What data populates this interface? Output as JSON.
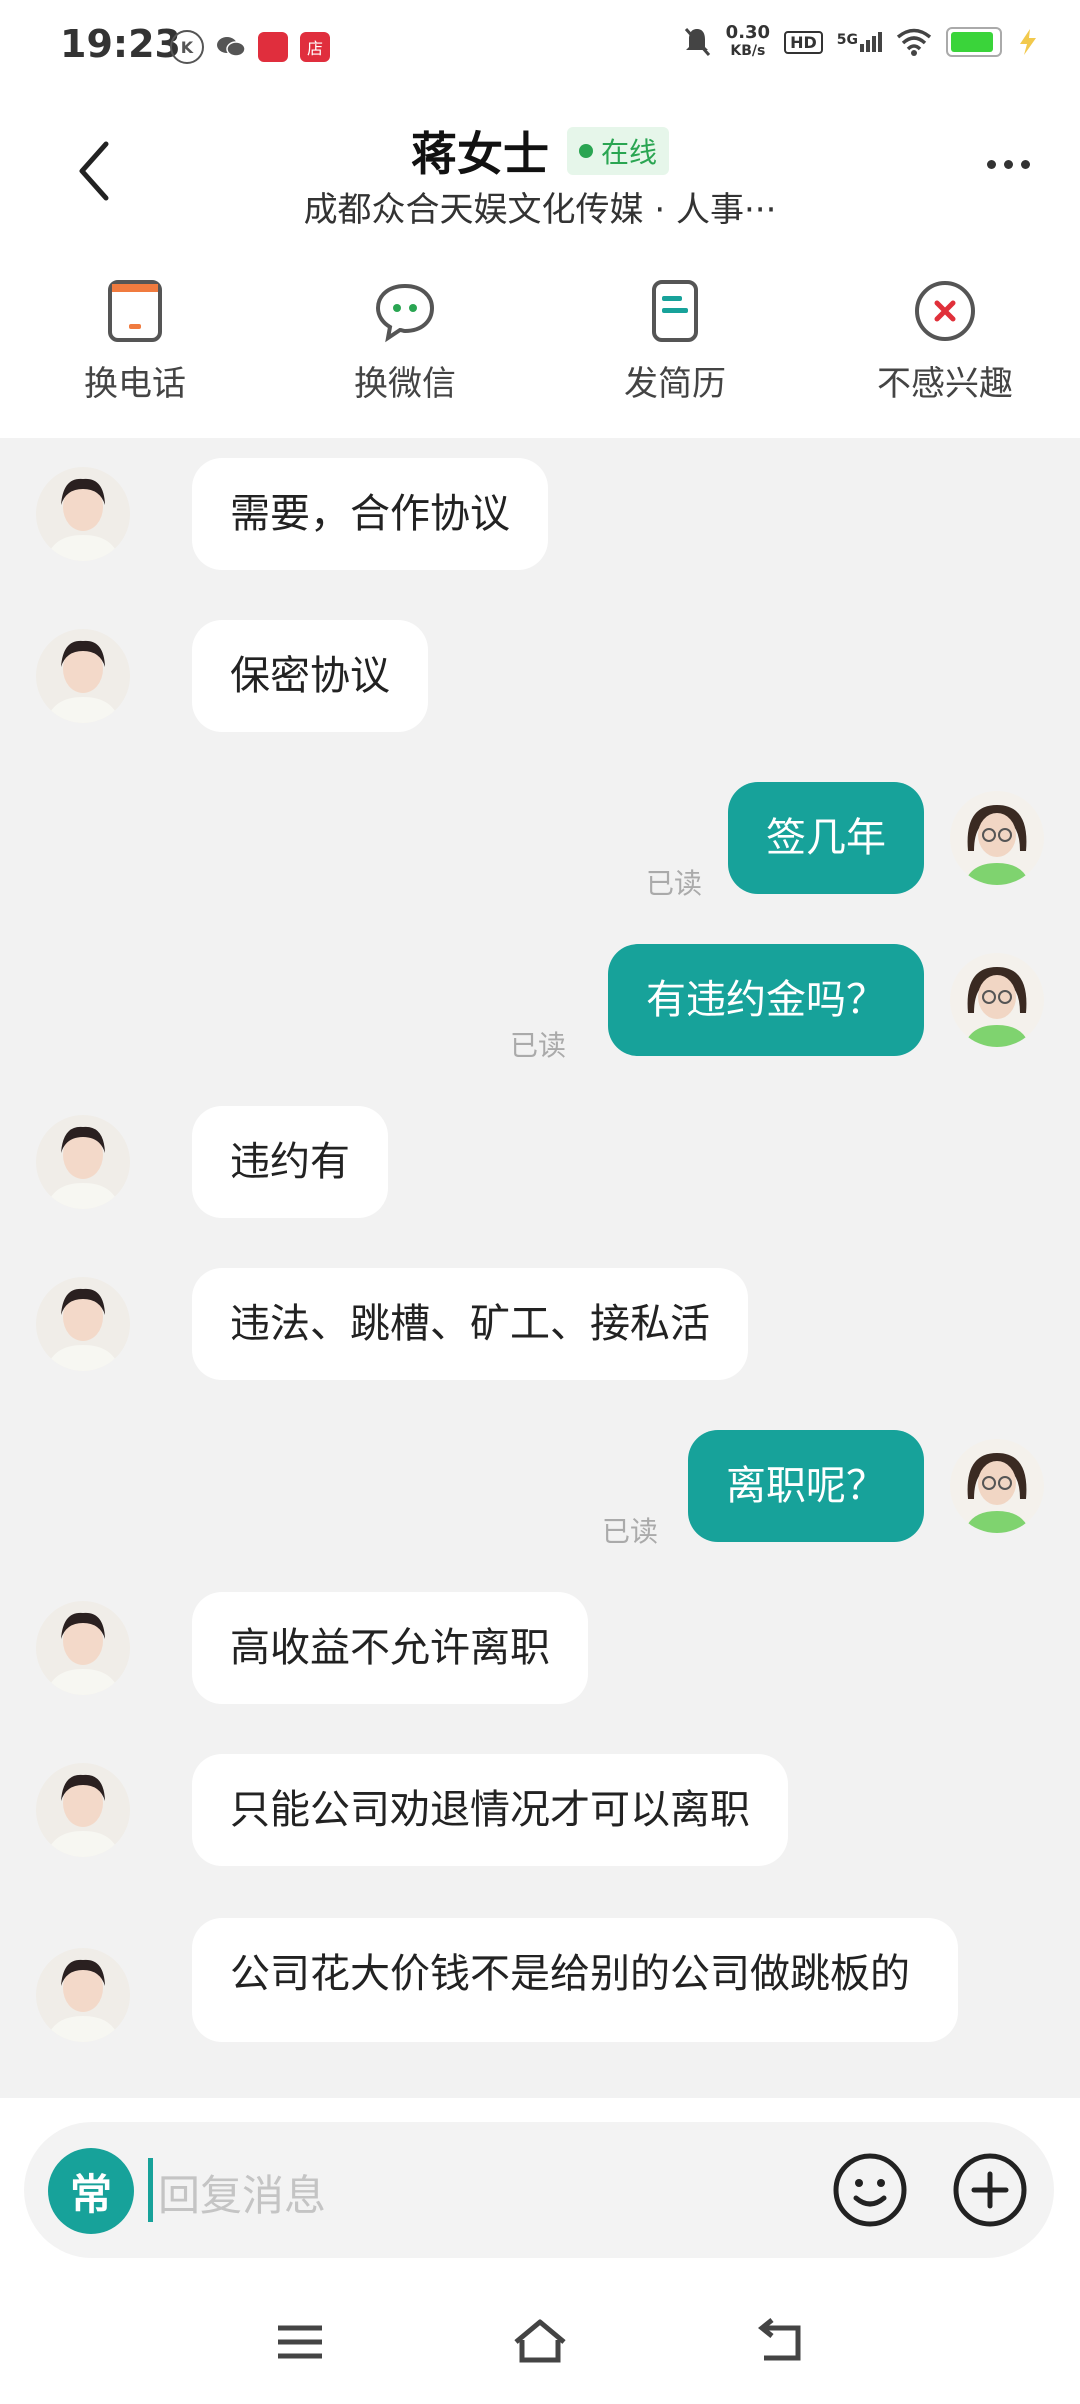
{
  "status_bar": {
    "time": "19:23",
    "net_speed_value": "0.30",
    "net_speed_unit": "KB/s",
    "hd": "HD",
    "signal": "5G",
    "battery_color": "#3ad43a",
    "app_icons": [
      "k-app-icon",
      "wechat-icon",
      "xiaohongshu-icon",
      "shop-icon"
    ],
    "shop_label": "店"
  },
  "header": {
    "title": "蒋女士",
    "status": "在线",
    "subtitle": "成都众合天娱文化传媒 · 人事···"
  },
  "actions": [
    {
      "label": "换电话",
      "icon": "phone-icon"
    },
    {
      "label": "换微信",
      "icon": "wechat-chat-icon"
    },
    {
      "label": "发简历",
      "icon": "resume-icon"
    },
    {
      "label": "不感兴趣",
      "icon": "close-circle-icon"
    }
  ],
  "messages": [
    {
      "dir": "in",
      "text": "需要，合作协议"
    },
    {
      "dir": "in",
      "text": "保密协议"
    },
    {
      "dir": "out",
      "text": "签几年",
      "read": "已读"
    },
    {
      "dir": "out",
      "text": "有违约金吗？",
      "read": "已读"
    },
    {
      "dir": "in",
      "text": "违约有"
    },
    {
      "dir": "in",
      "text": "违法、跳槽、矿工、接私活"
    },
    {
      "dir": "out",
      "text": "离职呢？",
      "read": "已读"
    },
    {
      "dir": "in",
      "text": "高收益不允许离职"
    },
    {
      "dir": "in",
      "text": "只能公司劝退情况才可以离职"
    },
    {
      "dir": "in",
      "text": "公司花大价钱不是给别的公司做跳板的"
    }
  ],
  "input": {
    "quick_label": "常",
    "placeholder": "回复消息"
  },
  "colors": {
    "accent": "#17a29a",
    "online": "#2aa552"
  }
}
